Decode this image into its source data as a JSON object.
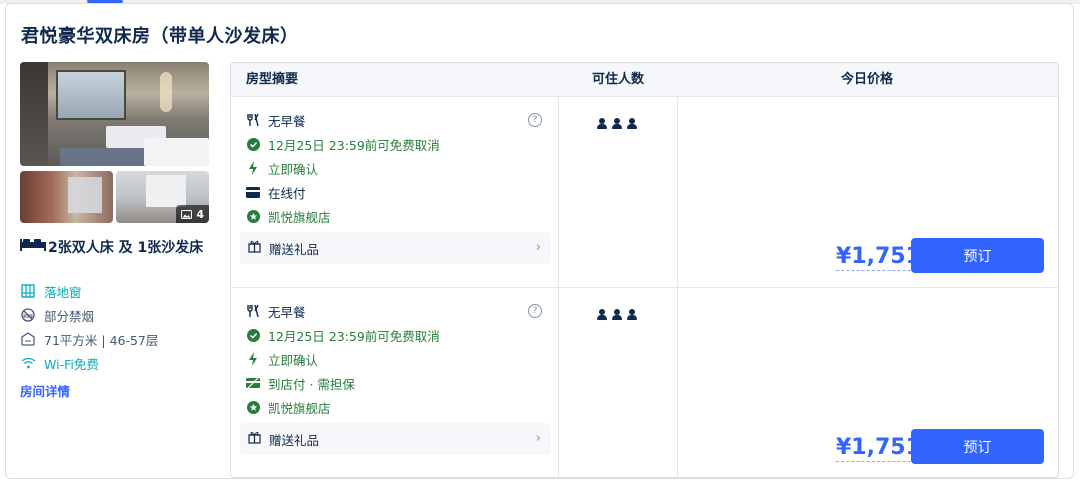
{
  "room": {
    "title": "君悦豪华双床房（带单人沙发床）",
    "photo_count": "4",
    "bed_info": "2张双人床 及 1张沙发床",
    "features": [
      {
        "label": "落地窗",
        "icon": "window-icon",
        "color": "#06aebd"
      },
      {
        "label": "部分禁烟",
        "icon": "no-smoking-icon",
        "color": "#455873"
      },
      {
        "label": "71平方米 | 46-57层",
        "icon": "area-icon",
        "color": "#455873"
      },
      {
        "label": "Wi-Fi免费",
        "icon": "wifi-icon",
        "color": "#06aebd"
      }
    ],
    "detail_link": "房间详情"
  },
  "table": {
    "headers": {
      "summary": "房型摘要",
      "occupancy": "可住人数",
      "price": "今日价格"
    },
    "rows": [
      {
        "breakfast": "无早餐",
        "cancel": "12月25日 23:59前可免费取消",
        "confirm": "立即确认",
        "payment": "在线付",
        "store": "凯悦旗舰店",
        "gift": "赠送礼品",
        "occupancy_count": 3,
        "price": "¥1,751",
        "book_label": "预订"
      },
      {
        "breakfast": "无早餐",
        "cancel": "12月25日 23:59前可免费取消",
        "confirm": "立即确认",
        "payment": "到店付 · 需担保",
        "store": "凯悦旗舰店",
        "gift": "赠送礼品",
        "occupancy_count": 3,
        "price": "¥1,751",
        "book_label": "预订"
      }
    ]
  },
  "colors": {
    "accent": "#3264ff",
    "green": "#287d3c",
    "teal": "#06aebd",
    "text": "#0f294d"
  }
}
